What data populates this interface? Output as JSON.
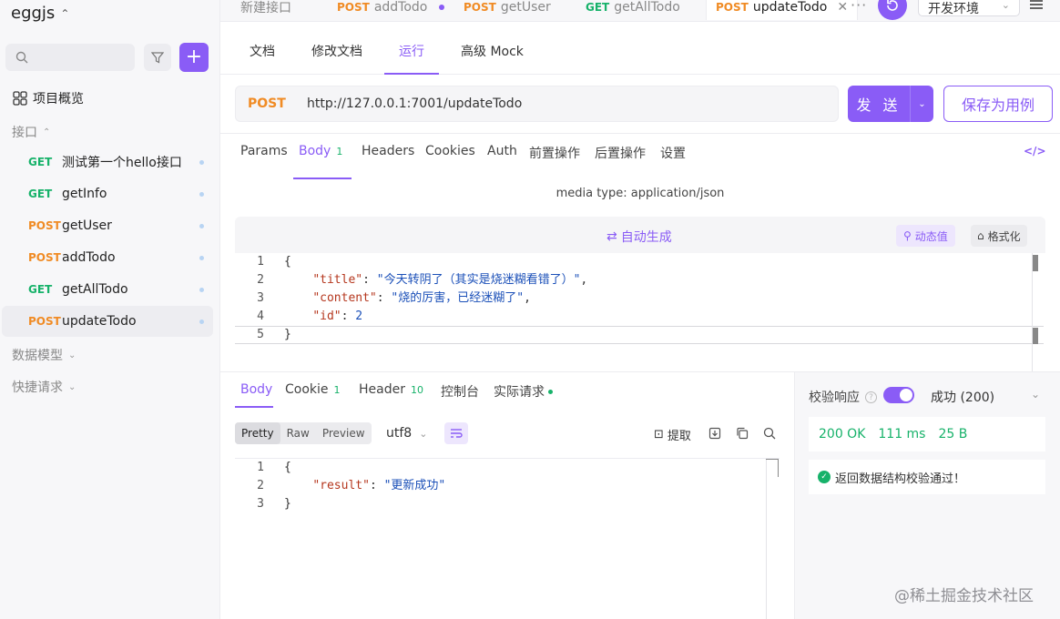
{
  "sidebar": {
    "project": "eggjs",
    "overview": "项目概览",
    "section_api": "接口",
    "apis": [
      {
        "method": "GET",
        "name": "测试第一个hello接口"
      },
      {
        "method": "GET",
        "name": "getInfo"
      },
      {
        "method": "POST",
        "name": "getUser"
      },
      {
        "method": "POST",
        "name": "addTodo"
      },
      {
        "method": "GET",
        "name": "getAllTodo"
      },
      {
        "method": "POST",
        "name": "updateTodo"
      }
    ],
    "section_models": "数据模型",
    "section_quick": "快捷请求"
  },
  "tabs": [
    {
      "method": "",
      "name": "新建接口"
    },
    {
      "method": "POST",
      "name": "addTodo"
    },
    {
      "method": "POST",
      "name": "getUser"
    },
    {
      "method": "GET",
      "name": "getAllTodo"
    },
    {
      "method": "POST",
      "name": "updateTodo"
    }
  ],
  "env": "开发环境",
  "subtabs": [
    "文档",
    "修改文档",
    "运行",
    "高级 Mock"
  ],
  "request": {
    "method": "POST",
    "url": "http://127.0.0.1:7001/updateTodo",
    "send": "发 送",
    "save_case": "保存为用例"
  },
  "req_tabs": {
    "params": "Params",
    "body": "Body",
    "body_count": "1",
    "headers": "Headers",
    "cookies": "Cookies",
    "auth": "Auth",
    "pre": "前置操作",
    "post": "后置操作",
    "settings": "设置"
  },
  "media_type": "media type: application/json",
  "editor": {
    "autogen": "自动生成",
    "dynamic": "动态值",
    "format": "格式化",
    "lines": [
      {
        "n": "1",
        "key": "",
        "val": "",
        "text": "{"
      },
      {
        "n": "2",
        "key": "\"title\"",
        "val": "\"今天转阴了（其实是烧迷糊看错了）\"",
        "text": ","
      },
      {
        "n": "3",
        "key": "\"content\"",
        "val": "\"烧的厉害，已经迷糊了\"",
        "text": ","
      },
      {
        "n": "4",
        "key": "\"id\"",
        "val": "2",
        "text": ""
      },
      {
        "n": "5",
        "key": "",
        "val": "",
        "text": "}"
      }
    ]
  },
  "response": {
    "tabs": {
      "body": "Body",
      "cookie": "Cookie",
      "cookie_count": "1",
      "header": "Header",
      "header_count": "10",
      "console": "控制台",
      "actual": "实际请求"
    },
    "views": [
      "Pretty",
      "Raw",
      "Preview"
    ],
    "encoding": "utf8",
    "extract": "提取",
    "lines": [
      {
        "n": "1",
        "text": "{"
      },
      {
        "n": "2",
        "key": "\"result\"",
        "val": "\"更新成功\""
      },
      {
        "n": "3",
        "text": "}"
      }
    ],
    "validate_label": "校验响应",
    "status_select": "成功 (200)",
    "status": "200 OK",
    "time": "111 ms",
    "size": "25 B",
    "check_msg": "返回数据结构校验通过！"
  },
  "watermark": "@稀土掘金技术社区"
}
